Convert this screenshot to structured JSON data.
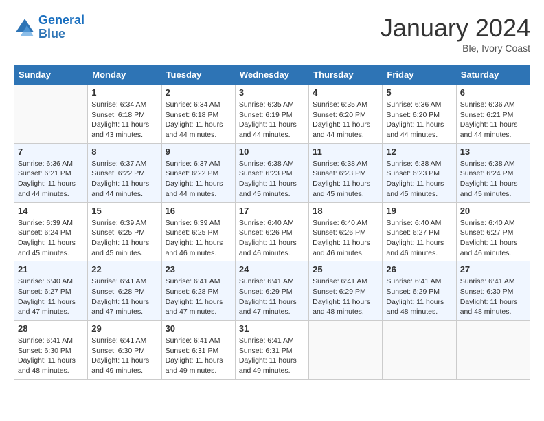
{
  "header": {
    "logo_line1": "General",
    "logo_line2": "Blue",
    "title": "January 2024",
    "subtitle": "Ble, Ivory Coast"
  },
  "days_of_week": [
    "Sunday",
    "Monday",
    "Tuesday",
    "Wednesday",
    "Thursday",
    "Friday",
    "Saturday"
  ],
  "weeks": [
    [
      {
        "num": "",
        "info": ""
      },
      {
        "num": "1",
        "info": "Sunrise: 6:34 AM\nSunset: 6:18 PM\nDaylight: 11 hours\nand 43 minutes."
      },
      {
        "num": "2",
        "info": "Sunrise: 6:34 AM\nSunset: 6:18 PM\nDaylight: 11 hours\nand 44 minutes."
      },
      {
        "num": "3",
        "info": "Sunrise: 6:35 AM\nSunset: 6:19 PM\nDaylight: 11 hours\nand 44 minutes."
      },
      {
        "num": "4",
        "info": "Sunrise: 6:35 AM\nSunset: 6:20 PM\nDaylight: 11 hours\nand 44 minutes."
      },
      {
        "num": "5",
        "info": "Sunrise: 6:36 AM\nSunset: 6:20 PM\nDaylight: 11 hours\nand 44 minutes."
      },
      {
        "num": "6",
        "info": "Sunrise: 6:36 AM\nSunset: 6:21 PM\nDaylight: 11 hours\nand 44 minutes."
      }
    ],
    [
      {
        "num": "7",
        "info": "Sunrise: 6:36 AM\nSunset: 6:21 PM\nDaylight: 11 hours\nand 44 minutes."
      },
      {
        "num": "8",
        "info": "Sunrise: 6:37 AM\nSunset: 6:22 PM\nDaylight: 11 hours\nand 44 minutes."
      },
      {
        "num": "9",
        "info": "Sunrise: 6:37 AM\nSunset: 6:22 PM\nDaylight: 11 hours\nand 44 minutes."
      },
      {
        "num": "10",
        "info": "Sunrise: 6:38 AM\nSunset: 6:23 PM\nDaylight: 11 hours\nand 45 minutes."
      },
      {
        "num": "11",
        "info": "Sunrise: 6:38 AM\nSunset: 6:23 PM\nDaylight: 11 hours\nand 45 minutes."
      },
      {
        "num": "12",
        "info": "Sunrise: 6:38 AM\nSunset: 6:23 PM\nDaylight: 11 hours\nand 45 minutes."
      },
      {
        "num": "13",
        "info": "Sunrise: 6:38 AM\nSunset: 6:24 PM\nDaylight: 11 hours\nand 45 minutes."
      }
    ],
    [
      {
        "num": "14",
        "info": "Sunrise: 6:39 AM\nSunset: 6:24 PM\nDaylight: 11 hours\nand 45 minutes."
      },
      {
        "num": "15",
        "info": "Sunrise: 6:39 AM\nSunset: 6:25 PM\nDaylight: 11 hours\nand 45 minutes."
      },
      {
        "num": "16",
        "info": "Sunrise: 6:39 AM\nSunset: 6:25 PM\nDaylight: 11 hours\nand 46 minutes."
      },
      {
        "num": "17",
        "info": "Sunrise: 6:40 AM\nSunset: 6:26 PM\nDaylight: 11 hours\nand 46 minutes."
      },
      {
        "num": "18",
        "info": "Sunrise: 6:40 AM\nSunset: 6:26 PM\nDaylight: 11 hours\nand 46 minutes."
      },
      {
        "num": "19",
        "info": "Sunrise: 6:40 AM\nSunset: 6:27 PM\nDaylight: 11 hours\nand 46 minutes."
      },
      {
        "num": "20",
        "info": "Sunrise: 6:40 AM\nSunset: 6:27 PM\nDaylight: 11 hours\nand 46 minutes."
      }
    ],
    [
      {
        "num": "21",
        "info": "Sunrise: 6:40 AM\nSunset: 6:27 PM\nDaylight: 11 hours\nand 47 minutes."
      },
      {
        "num": "22",
        "info": "Sunrise: 6:41 AM\nSunset: 6:28 PM\nDaylight: 11 hours\nand 47 minutes."
      },
      {
        "num": "23",
        "info": "Sunrise: 6:41 AM\nSunset: 6:28 PM\nDaylight: 11 hours\nand 47 minutes."
      },
      {
        "num": "24",
        "info": "Sunrise: 6:41 AM\nSunset: 6:29 PM\nDaylight: 11 hours\nand 47 minutes."
      },
      {
        "num": "25",
        "info": "Sunrise: 6:41 AM\nSunset: 6:29 PM\nDaylight: 11 hours\nand 48 minutes."
      },
      {
        "num": "26",
        "info": "Sunrise: 6:41 AM\nSunset: 6:29 PM\nDaylight: 11 hours\nand 48 minutes."
      },
      {
        "num": "27",
        "info": "Sunrise: 6:41 AM\nSunset: 6:30 PM\nDaylight: 11 hours\nand 48 minutes."
      }
    ],
    [
      {
        "num": "28",
        "info": "Sunrise: 6:41 AM\nSunset: 6:30 PM\nDaylight: 11 hours\nand 48 minutes."
      },
      {
        "num": "29",
        "info": "Sunrise: 6:41 AM\nSunset: 6:30 PM\nDaylight: 11 hours\nand 49 minutes."
      },
      {
        "num": "30",
        "info": "Sunrise: 6:41 AM\nSunset: 6:31 PM\nDaylight: 11 hours\nand 49 minutes."
      },
      {
        "num": "31",
        "info": "Sunrise: 6:41 AM\nSunset: 6:31 PM\nDaylight: 11 hours\nand 49 minutes."
      },
      {
        "num": "",
        "info": ""
      },
      {
        "num": "",
        "info": ""
      },
      {
        "num": "",
        "info": ""
      }
    ]
  ]
}
